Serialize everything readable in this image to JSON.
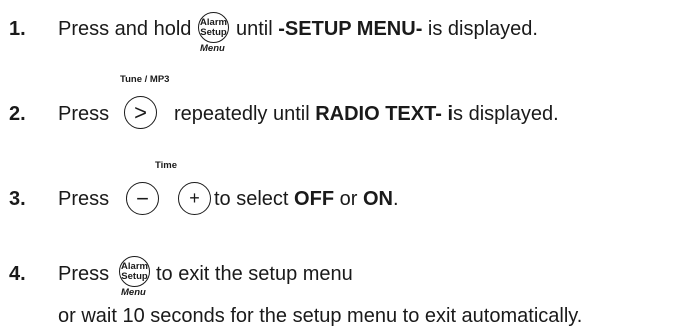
{
  "steps": [
    {
      "number": "1.",
      "text_before": "Press and hold",
      "button_top": "Alarm",
      "button_bottom": "Setup",
      "button_caption": "Menu",
      "text_after": "until",
      "bold": "-SETUP MENU-",
      "text_end": "is displayed."
    },
    {
      "number": "2.",
      "text_before": "Press",
      "button_caption": "Tune / MP3",
      "button_symbol": ">",
      "text_after": "repeatedly until",
      "bold": "RADIO TEXT- i",
      "text_end": "s displayed."
    },
    {
      "number": "3.",
      "text_before": "Press",
      "button_caption": "Time",
      "minus_symbol": "−",
      "plus_symbol": "+",
      "text_after": "to select",
      "bold_off": "OFF",
      "or": "or",
      "bold_on": "ON",
      "period": "."
    },
    {
      "number": "4.",
      "text_before": "Press",
      "button_top": "Alarm",
      "button_bottom": "Setup",
      "button_caption": "Menu",
      "text_after": "to exit the setup menu",
      "continuation": "or wait 10 seconds for the setup menu to exit automatically."
    }
  ]
}
